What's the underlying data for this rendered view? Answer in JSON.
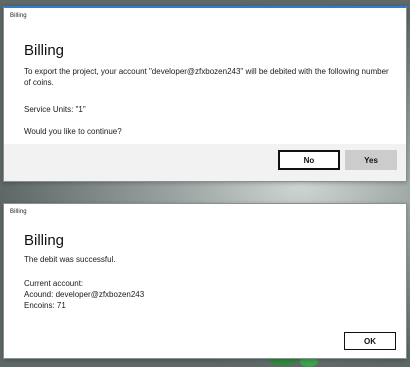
{
  "dialog_export": {
    "window_title": "Billing",
    "heading": "Billing",
    "message": "To export the project, your account \"developer@zfxbozen243\" will be debited with the following number of coins.",
    "service_units": "Service Units: \"1\"",
    "question": "Would you like to continue?",
    "no_label": "No",
    "yes_label": "Yes"
  },
  "dialog_success": {
    "window_title": "Billing",
    "heading": "Billing",
    "message": "The debit was successful.",
    "current_account_label": "Current account:",
    "account_line": "Acound: developer@zfxbozen243",
    "encoins_line": "Encoins: 71",
    "ok_label": "OK"
  },
  "colors": {
    "accent": "#2a7fd4",
    "dialog_bg": "#ffffff",
    "footer_bg": "#f2f2f2",
    "yes_button_bg": "#cccccc"
  }
}
